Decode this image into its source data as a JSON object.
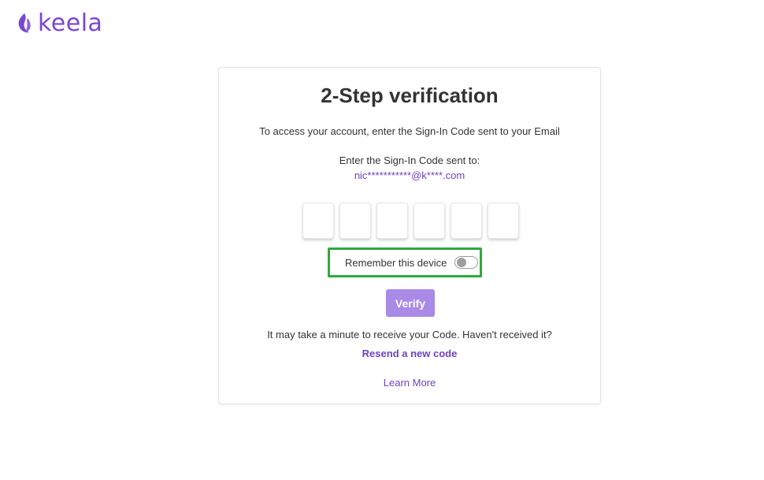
{
  "brand": {
    "name": "keela",
    "logo_icon": "flame-leaf-icon",
    "color": "#7a45d6"
  },
  "card": {
    "title": "2-Step verification",
    "subtitle": "To access your account, enter the Sign-In Code sent to your Email",
    "sent_to_label": "Enter the Sign-In Code sent to:",
    "email_masked": "nic***********@k****.com",
    "code_digits": [
      "",
      "",
      "",
      "",
      "",
      ""
    ],
    "remember_label": "Remember this device",
    "remember_enabled": false,
    "verify_label": "Verify",
    "note": "It may take a minute to receive your Code. Haven't received it?",
    "resend_label": "Resend a new code",
    "learn_more_label": "Learn More"
  },
  "colors": {
    "accent": "#6f42c1",
    "button_disabled": "#a98ae6",
    "highlight": "#2eaa3d"
  }
}
